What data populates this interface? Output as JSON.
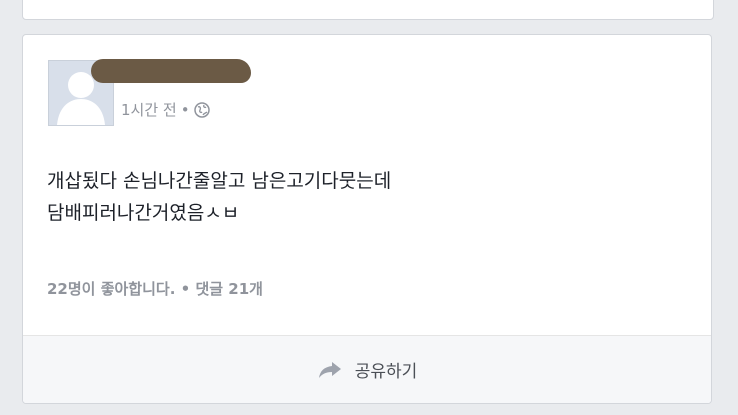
{
  "post": {
    "timestamp": "1시간 전",
    "privacy_separator": "•",
    "privacy_icon": "globe-icon",
    "body_lines": [
      "개삽됬다 손님나간줄알고 남은고기다뭇는데",
      "담배피러나간거였음ㅅㅂ"
    ],
    "likes_text": "22명이 좋아합니다.",
    "counts_separator": "•",
    "comments_text": "댓글 21개"
  },
  "actions": {
    "share_label": "공유하기",
    "share_icon": "share-arrow-icon"
  },
  "colors": {
    "page_background": "#e9ebee",
    "card_background": "#ffffff",
    "text_primary": "#1d2129",
    "text_secondary": "#90949c"
  }
}
